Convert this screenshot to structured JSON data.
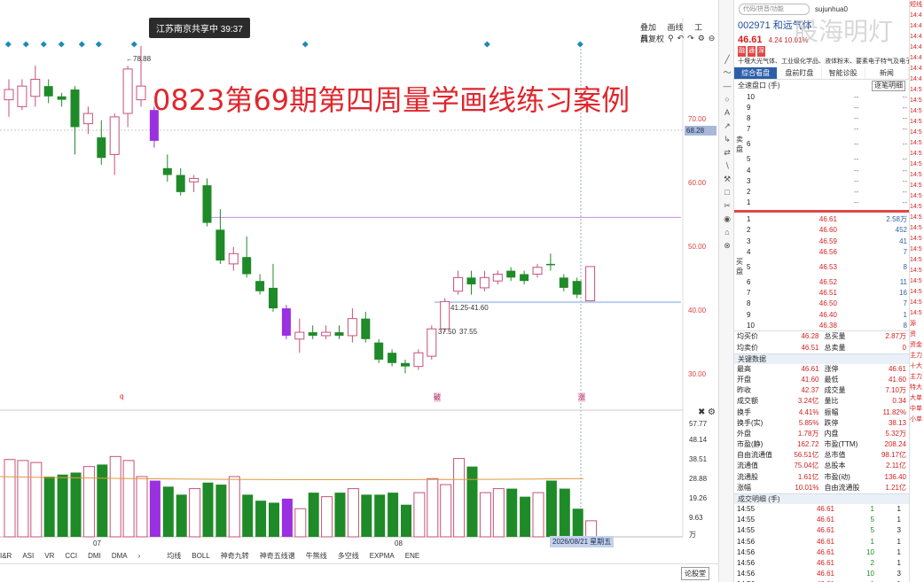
{
  "chart": {
    "live_badge": "江苏南京共享中 39:37",
    "overlay_title": "0823第69期第四周量学画线练习案例",
    "toolbar": {
      "item1": "叠加",
      "item2": "画线",
      "item3": "工具"
    },
    "toolbar2": {
      "label": "前复权"
    },
    "price_tag": "68.28",
    "price_labels": [
      "70.00",
      "60.00",
      "50.00",
      "40.00",
      "30.00"
    ],
    "high_annotation": "←78.88",
    "level_annotation": "41.25-41.60",
    "annot_a": "37.50",
    "annot_b": "37.55",
    "vol_labels": [
      "57.77",
      "48.14",
      "38.51",
      "28.88",
      "19.26",
      "9.63",
      "万"
    ],
    "date_tag": "2026/08/21 星期五",
    "x_labels": [
      "07",
      "08"
    ],
    "mark_q": "q",
    "mark_buy": "破",
    "mark_sell": "涨"
  },
  "indicator_tabs": [
    "I&R",
    "ASI",
    "VR",
    "CCI",
    "DMI",
    "DMA",
    "›",
    "均线",
    "BOLL",
    "神奇九转",
    "神奇五线谱",
    "牛熊线",
    "多空线",
    "EXPMA",
    "ENE"
  ],
  "status_button": "论股堂",
  "draw_tools": [
    "╱",
    "〜",
    "—",
    "○",
    "A",
    "↗",
    "↳",
    "⇄",
    "∖",
    "⚒",
    "□",
    "✂",
    "◉",
    "⌂",
    "⊗"
  ],
  "quote": {
    "search_placeholder": "代码/拼音/功能",
    "user": "sujunhua0",
    "watermark": "股海明灯",
    "stock": "002971 和远气体",
    "price": "46.61",
    "change": "4.24 10.01%",
    "tags": [
      "融",
      "通",
      "深"
    ],
    "concept": "十堰大光气体、工业级化学品、液体粉末、要素电子特气及电子化",
    "tabs": [
      "综合看盘",
      "盘前盯盘",
      "智能诊股",
      "新闻"
    ],
    "sub_left": "全速盘口 (手)",
    "sub_btn": "逐笔明细",
    "asks": [
      {
        "lvl": "10",
        "p": "--",
        "v": "--"
      },
      {
        "lvl": "9",
        "p": "--",
        "v": "--"
      },
      {
        "lvl": "8",
        "p": "--",
        "v": "--"
      },
      {
        "lvl": "7",
        "p": "--",
        "v": "--"
      },
      {
        "lvl": "6",
        "p": "--",
        "v": "--"
      },
      {
        "lvl": "5",
        "p": "--",
        "v": "--"
      },
      {
        "lvl": "4",
        "p": "--",
        "v": "--"
      },
      {
        "lvl": "3",
        "p": "--",
        "v": "--"
      },
      {
        "lvl": "2",
        "p": "--",
        "v": "--"
      },
      {
        "lvl": "1",
        "p": "--",
        "v": "--"
      }
    ],
    "ask_label": "卖盘",
    "bid_label": "买盘",
    "bids": [
      {
        "lvl": "1",
        "p": "46.61",
        "v": "2.58万"
      },
      {
        "lvl": "2",
        "p": "46.60",
        "v": "452"
      },
      {
        "lvl": "3",
        "p": "46.59",
        "v": "41"
      },
      {
        "lvl": "4",
        "p": "46.56",
        "v": "7"
      },
      {
        "lvl": "5",
        "p": "46.53",
        "v": "8"
      },
      {
        "lvl": "6",
        "p": "46.52",
        "v": "11"
      },
      {
        "lvl": "7",
        "p": "46.51",
        "v": "16"
      },
      {
        "lvl": "8",
        "p": "46.50",
        "v": "7"
      },
      {
        "lvl": "9",
        "p": "46.40",
        "v": "1"
      },
      {
        "lvl": "10",
        "p": "46.38",
        "v": "8"
      }
    ],
    "avg_rows": [
      {
        "k1": "均买价",
        "v1": "46.28",
        "k2": "总买量",
        "v2": "2.87万"
      },
      {
        "k1": "均卖价",
        "v1": "46.51",
        "k2": "总卖量",
        "v2": "0"
      }
    ],
    "key_head": "关键数据",
    "key_rows": [
      {
        "k1": "最高",
        "v1": "46.61",
        "k2": "涨停",
        "v2": "46.61"
      },
      {
        "k1": "开盘",
        "v1": "41.60",
        "k2": "最低",
        "v2": "41.60"
      },
      {
        "k1": "昨收",
        "v1": "42.37",
        "k2": "成交量",
        "v2": "7.10万"
      },
      {
        "k1": "成交额",
        "v1": "3.24亿",
        "k2": "量比",
        "v2": "0.34"
      },
      {
        "k1": "换手",
        "v1": "4.41%",
        "k2": "振幅",
        "v2": "11.82%"
      },
      {
        "k1": "换手(实)",
        "v1": "5.85%",
        "k2": "跌停",
        "v2": "38.13"
      },
      {
        "k1": "外盘",
        "v1": "1.78万",
        "k2": "内盘",
        "v2": "5.32万"
      },
      {
        "k1": "市盈(静)",
        "v1": "162.72",
        "k2": "市盈(TTM)",
        "v2": "208.24"
      },
      {
        "k1": "自由流通值",
        "v1": "56.51亿",
        "k2": "总市值",
        "v2": "98.17亿"
      },
      {
        "k1": "流通值",
        "v1": "75.04亿",
        "k2": "总股本",
        "v2": "2.11亿"
      },
      {
        "k1": "流通股",
        "v1": "1.61亿",
        "k2": "市盈(动)",
        "v2": "136.40"
      },
      {
        "k1": "涨幅",
        "v1": "10.01%",
        "k2": "自由流通股",
        "v2": "1.21亿"
      }
    ],
    "tick_head": "成交明细 (手)",
    "ticks": [
      {
        "t": "14:55",
        "p": "46.61",
        "v": "1",
        "n": "1"
      },
      {
        "t": "14:55",
        "p": "46.61",
        "v": "5",
        "n": "1"
      },
      {
        "t": "14:55",
        "p": "46.61",
        "v": "5",
        "n": "3"
      },
      {
        "t": "14:56",
        "p": "46.61",
        "v": "1",
        "n": "1"
      },
      {
        "t": "14:56",
        "p": "46.61",
        "v": "10",
        "n": "1"
      },
      {
        "t": "14:56",
        "p": "46.61",
        "v": "2",
        "n": "1"
      },
      {
        "t": "14:56",
        "p": "46.61",
        "v": "10",
        "n": "3"
      },
      {
        "t": "14:56",
        "p": "46.61",
        "v": "1",
        "n": "1"
      }
    ]
  },
  "right_strip": [
    "短线",
    "14:4",
    "14:4",
    "14:4",
    "14:4",
    "14:4",
    "14:4",
    "14:4",
    "14:5",
    "14:5",
    "14:5",
    "14:5",
    "14:5",
    "14:5",
    "14:5",
    "14:5",
    "14:5",
    "14:5",
    "14:5",
    "14:5",
    "14:5",
    "14:5",
    "14:5",
    "14:5",
    "14:5",
    "14:5",
    "14:5",
    "14:5",
    "14:5",
    "14:5",
    "源",
    "资",
    "资金",
    "主力",
    "十大",
    "主力",
    "特大",
    "大单",
    "中单",
    "小单"
  ],
  "chart_data": {
    "type": "candlestick",
    "ylim": [
      26,
      83
    ],
    "candles": [
      {
        "o": 71.0,
        "c": 72.5,
        "h": 74.0,
        "l": 68.5,
        "up": true
      },
      {
        "o": 70.0,
        "c": 73.0,
        "h": 74.0,
        "l": 69.5,
        "up": true
      },
      {
        "o": 71.5,
        "c": 74.0,
        "h": 76.0,
        "l": 70.0,
        "up": true
      },
      {
        "o": 73.0,
        "c": 71.5,
        "h": 74.0,
        "l": 70.5,
        "up": false
      },
      {
        "o": 71.5,
        "c": 71.0,
        "h": 72.0,
        "l": 70.0,
        "up": false
      },
      {
        "o": 72.5,
        "c": 67.0,
        "h": 73.0,
        "l": 63.0,
        "up": false
      },
      {
        "o": 67.5,
        "c": 69.0,
        "h": 70.0,
        "l": 66.0,
        "up": true
      },
      {
        "o": 65.5,
        "c": 62.5,
        "h": 68.0,
        "l": 61.5,
        "up": false
      },
      {
        "o": 63.0,
        "c": 68.5,
        "h": 69.0,
        "l": 60.0,
        "up": true
      },
      {
        "o": 69.0,
        "c": 75.5,
        "h": 76.0,
        "l": 67.0,
        "up": true
      },
      {
        "o": 71.0,
        "c": 73.0,
        "h": 78.88,
        "l": 70.0,
        "up": true
      },
      {
        "o": 69.5,
        "c": 65.0,
        "h": 70.0,
        "l": 64.0,
        "up": false,
        "purple": true
      },
      {
        "o": 61.0,
        "c": 60.0,
        "h": 63.0,
        "l": 59.0,
        "up": false
      },
      {
        "o": 60.0,
        "c": 57.5,
        "h": 61.0,
        "l": 57.0,
        "up": false
      },
      {
        "o": 59.0,
        "c": 59.5,
        "h": 60.0,
        "l": 57.5,
        "up": true
      },
      {
        "o": 58.5,
        "c": 53.0,
        "h": 59.5,
        "l": 52.5,
        "up": false
      },
      {
        "o": 52.0,
        "c": 47.5,
        "h": 55.0,
        "l": 47.0,
        "up": false
      },
      {
        "o": 47.0,
        "c": 48.5,
        "h": 49.5,
        "l": 46.0,
        "up": true
      },
      {
        "o": 48.0,
        "c": 45.5,
        "h": 51.0,
        "l": 45.0,
        "up": false
      },
      {
        "o": 44.5,
        "c": 43.0,
        "h": 45.5,
        "l": 42.5,
        "up": false
      },
      {
        "o": 43.5,
        "c": 40.5,
        "h": 47.0,
        "l": 40.0,
        "up": false
      },
      {
        "o": 40.5,
        "c": 36.5,
        "h": 41.0,
        "l": 36.0,
        "up": false,
        "purple": true
      },
      {
        "o": 36.0,
        "c": 37.0,
        "h": 39.0,
        "l": 34.0,
        "up": true
      },
      {
        "o": 37.0,
        "c": 36.5,
        "h": 38.0,
        "l": 36.0,
        "up": false
      },
      {
        "o": 36.5,
        "c": 37.0,
        "h": 38.0,
        "l": 36.0,
        "up": true
      },
      {
        "o": 37.0,
        "c": 36.5,
        "h": 38.0,
        "l": 36.0,
        "up": false
      },
      {
        "o": 36.5,
        "c": 39.0,
        "h": 40.5,
        "l": 35.5,
        "up": true
      },
      {
        "o": 39.0,
        "c": 36.0,
        "h": 40.0,
        "l": 35.5,
        "up": false
      },
      {
        "o": 35.5,
        "c": 33.0,
        "h": 36.0,
        "l": 32.5,
        "up": false
      },
      {
        "o": 34.0,
        "c": 32.5,
        "h": 34.5,
        "l": 32.0,
        "up": false
      },
      {
        "o": 32.5,
        "c": 32.0,
        "h": 33.0,
        "l": 31.0,
        "up": false
      },
      {
        "o": 32.0,
        "c": 34.0,
        "h": 34.5,
        "l": 31.5,
        "up": true
      },
      {
        "o": 33.5,
        "c": 37.5,
        "h": 38.0,
        "l": 33.0,
        "up": true
      },
      {
        "o": 37.5,
        "c": 41.5,
        "h": 42.0,
        "l": 37.0,
        "up": true
      },
      {
        "o": 43.0,
        "c": 45.0,
        "h": 46.0,
        "l": 42.5,
        "up": true
      },
      {
        "o": 45.0,
        "c": 44.0,
        "h": 46.0,
        "l": 42.5,
        "up": false
      },
      {
        "o": 43.5,
        "c": 45.0,
        "h": 46.0,
        "l": 43.0,
        "up": true
      },
      {
        "o": 44.5,
        "c": 45.5,
        "h": 46.0,
        "l": 44.0,
        "up": true
      },
      {
        "o": 46.0,
        "c": 45.0,
        "h": 46.5,
        "l": 44.5,
        "up": false
      },
      {
        "o": 45.5,
        "c": 44.5,
        "h": 46.0,
        "l": 44.0,
        "up": false
      },
      {
        "o": 45.5,
        "c": 46.5,
        "h": 47.0,
        "l": 45.0,
        "up": true
      },
      {
        "o": 47.0,
        "c": 47.0,
        "h": 48.5,
        "l": 46.0,
        "up": false
      },
      {
        "o": 45.0,
        "c": 43.5,
        "h": 45.5,
        "l": 43.0,
        "up": false
      },
      {
        "o": 44.5,
        "c": 42.5,
        "h": 45.0,
        "l": 42.0,
        "up": false
      },
      {
        "o": 41.6,
        "c": 46.61,
        "h": 46.61,
        "l": 41.6,
        "up": true
      }
    ],
    "volumes": [
      38.5,
      38.0,
      37.0,
      30.0,
      31.0,
      32.0,
      35.0,
      36.0,
      40.0,
      38.0,
      30.0,
      28.0,
      25.0,
      21.0,
      24.0,
      27.0,
      26.0,
      30.0,
      21.0,
      18.0,
      17.0,
      19.0,
      14.0,
      22.0,
      20.0,
      22.0,
      24.0,
      21.0,
      21.0,
      22.0,
      16.0,
      22.0,
      29.0,
      26.0,
      39.0,
      35.0,
      22.0,
      24.0,
      24.0,
      20.0,
      22.0,
      28.0,
      24.0,
      14.0,
      8.0
    ],
    "hlines": [
      {
        "y": 53.8,
        "color": "#c98be0"
      },
      {
        "y": 41.4,
        "color": "#b8d0ee"
      }
    ]
  }
}
